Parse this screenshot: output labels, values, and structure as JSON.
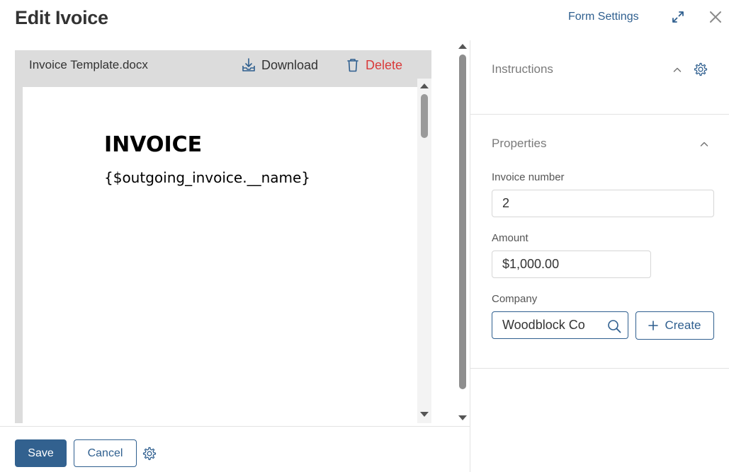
{
  "header": {
    "title": "Edit Ivoice",
    "form_settings": "Form Settings"
  },
  "document": {
    "filename": "Invoice Template.docx",
    "download_label": "Download",
    "delete_label": "Delete",
    "heading": "INVOICE",
    "placeholder_text": "{$outgoing_invoice.__name}"
  },
  "footer": {
    "save_label": "Save",
    "cancel_label": "Cancel"
  },
  "panel": {
    "instructions_title": "Instructions",
    "properties_title": "Properties",
    "fields": {
      "invoice_number_label": "Invoice number",
      "invoice_number_value": "2",
      "amount_label": "Amount",
      "amount_value": "$1,000.00",
      "company_label": "Company",
      "company_value": "Woodblock Co",
      "create_label": "Create"
    }
  },
  "colors": {
    "accent": "#32618f",
    "danger": "#d93a3a",
    "doc_background": "#dcdcdc"
  },
  "icons": [
    "expand-icon",
    "close-icon",
    "download-icon",
    "trash-icon",
    "gear-icon",
    "chevron-up-icon",
    "search-icon",
    "plus-icon"
  ]
}
